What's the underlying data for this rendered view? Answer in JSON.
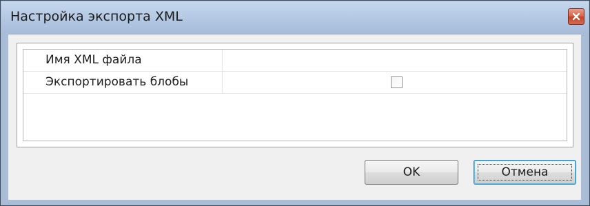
{
  "window": {
    "title": "Настройка экспорта XML"
  },
  "properties": [
    {
      "label": "Имя XML файла",
      "value": ""
    },
    {
      "label": "Экспортировать блобы",
      "checked": false
    }
  ],
  "buttons": {
    "ok_label": "OK",
    "cancel_label": "Отмена"
  },
  "colors": {
    "titlebar": "#b8cce6",
    "close_button": "#d96548",
    "dialog_body": "#f0f0f0",
    "focused_button_border": "#3c7fb1"
  },
  "icons": {
    "close": "close-icon"
  }
}
